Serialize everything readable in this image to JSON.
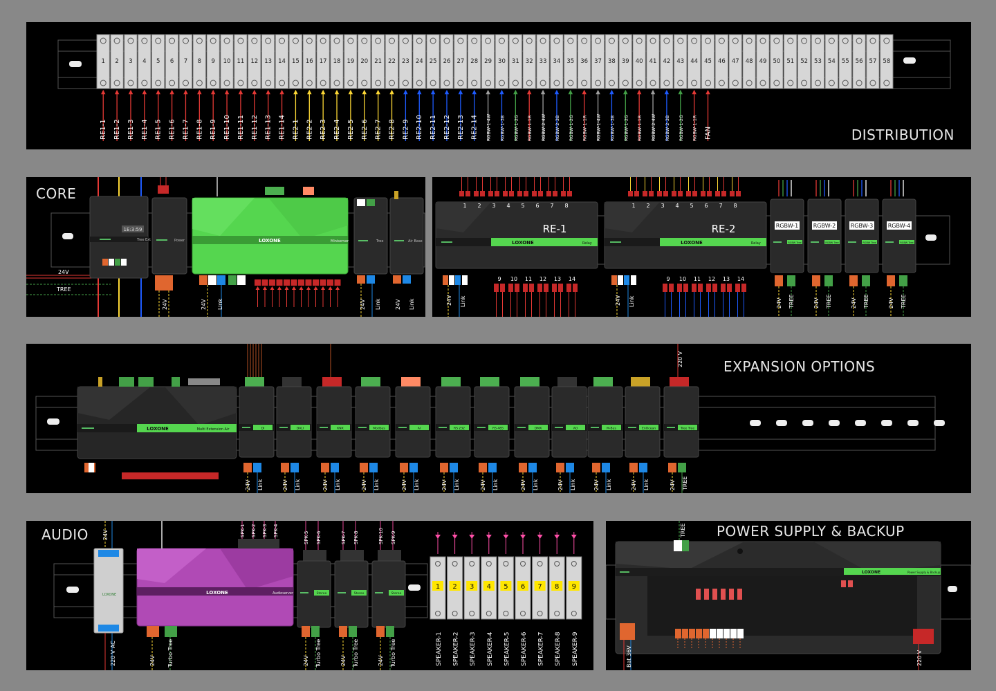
{
  "distribution": {
    "title": "DISTRIBUTION",
    "terminal_count": 58,
    "wires": [
      {
        "label": "RE1-1",
        "color": "#e53935"
      },
      {
        "label": "RE1-2",
        "color": "#e53935"
      },
      {
        "label": "RE1-3",
        "color": "#e53935"
      },
      {
        "label": "RE1-4",
        "color": "#e53935"
      },
      {
        "label": "RE1-5",
        "color": "#e53935"
      },
      {
        "label": "RE1-6",
        "color": "#e53935"
      },
      {
        "label": "RE1-7",
        "color": "#e53935"
      },
      {
        "label": "RE1-8",
        "color": "#e53935"
      },
      {
        "label": "RE1-9",
        "color": "#e53935"
      },
      {
        "label": "RE1-10",
        "color": "#e53935"
      },
      {
        "label": "RE1-11",
        "color": "#e53935"
      },
      {
        "label": "RE1-12",
        "color": "#e53935"
      },
      {
        "label": "RE1-13",
        "color": "#e53935"
      },
      {
        "label": "RE1-14",
        "color": "#e53935"
      },
      {
        "label": "RE2-1",
        "color": "#fdd835"
      },
      {
        "label": "RE2-2",
        "color": "#fdd835"
      },
      {
        "label": "RE2-3",
        "color": "#fdd835"
      },
      {
        "label": "RE2-4",
        "color": "#fdd835"
      },
      {
        "label": "RE2-5",
        "color": "#fdd835"
      },
      {
        "label": "RE2-6",
        "color": "#fdd835"
      },
      {
        "label": "RE2-7",
        "color": "#fdd835"
      },
      {
        "label": "RE2-8",
        "color": "#fdd835"
      },
      {
        "label": "RE2-9",
        "color": "#1e5bff"
      },
      {
        "label": "RE2-10",
        "color": "#1e5bff"
      },
      {
        "label": "RE2-11",
        "color": "#1e5bff"
      },
      {
        "label": "RE2-12",
        "color": "#1e5bff"
      },
      {
        "label": "RE2-13",
        "color": "#1e5bff"
      },
      {
        "label": "RE2-14",
        "color": "#1e5bff"
      },
      {
        "label": "RGBW-1-4W",
        "color": "#9e9e9e"
      },
      {
        "label": "RGBW-1-3B",
        "color": "#1e5bff"
      },
      {
        "label": "RGBW-1-2G",
        "color": "#43a047"
      },
      {
        "label": "RGBW-1-1R",
        "color": "#e53935"
      },
      {
        "label": "RGBW-2-4W",
        "color": "#9e9e9e"
      },
      {
        "label": "RGBW-2-3B",
        "color": "#1e5bff"
      },
      {
        "label": "RGBW-1-2G",
        "color": "#43a047"
      },
      {
        "label": "RGBW-1-1R",
        "color": "#e53935"
      },
      {
        "label": "RGBW-1-4W",
        "color": "#9e9e9e"
      },
      {
        "label": "RGBW-1-3B",
        "color": "#1e5bff"
      },
      {
        "label": "RGBW-1-2G",
        "color": "#43a047"
      },
      {
        "label": "RGBW-1-1R",
        "color": "#e53935"
      },
      {
        "label": "RGBW-2-4W",
        "color": "#9e9e9e"
      },
      {
        "label": "RGBW-2-3B",
        "color": "#1e5bff"
      },
      {
        "label": "RGBW-1-2G",
        "color": "#43a047"
      },
      {
        "label": "RGBW-1-1R",
        "color": "#e53935"
      },
      {
        "label": "FAN",
        "color": "#e53935"
      }
    ]
  },
  "core": {
    "title": "CORE",
    "wire_24v": "24V",
    "wire_tree": "TREE",
    "modules": {
      "tree_ext": "Tree Ext",
      "tree_id": "1E:3:59",
      "power": "Power",
      "miniserver_brand": "LOXONE",
      "miniserver_label": "Miniserver",
      "tree": "Tree",
      "air_base": "Air Base",
      "relay_brand": "LOXONE",
      "relay_label": "Relay",
      "re1": "RE-1",
      "re2": "RE-2",
      "rgbw": [
        "RGBW-1",
        "RGBW-2",
        "RGBW-3",
        "RGBW-4"
      ],
      "rgbw_label": "RGBW Tree"
    },
    "relay_top_numbers": [
      "1",
      "2",
      "3",
      "4",
      "5",
      "6",
      "7",
      "8"
    ],
    "relay_bottom_numbers": [
      "9",
      "10",
      "11",
      "12",
      "13",
      "14"
    ],
    "bottom_labels": {
      "v24": "24V",
      "link": "Link",
      "tree": "TREE"
    }
  },
  "expansion": {
    "title": "EXPANSION OPTIONS",
    "brand": "LOXONE",
    "big_label": "Multi Extension Air",
    "modules": [
      "DI",
      "DALI",
      "KNX",
      "Modbus",
      "AI",
      "RS 232",
      "RS 485",
      "DMX",
      "AO",
      "M-Bus",
      "EnOcean",
      "Tree Tree"
    ],
    "v220": "220 V",
    "v24": "24V",
    "link": "Link",
    "tree": "TREE"
  },
  "audio": {
    "title": "AUDIO",
    "brand": "LOXONE",
    "audioserver_label": "Audioserver",
    "stereo_label": "Stereo",
    "psu_brand": "LOXONE",
    "v24": "24V",
    "v220ac": "220 V AC",
    "turbo_tree": "Turbo Tree",
    "spk_top": [
      "SPK-1",
      "SPK-2",
      "SPK-3",
      "SPK-4"
    ],
    "spk_ext": [
      [
        "SPK-5",
        "SPK-6"
      ],
      [
        "SPK-7",
        "SPK-8"
      ],
      [
        "SPK-10",
        "SPK-9"
      ]
    ],
    "terminals": [
      "1",
      "2",
      "3",
      "4",
      "5",
      "6",
      "7",
      "8",
      "9"
    ],
    "speakers": [
      "SPEAKER-1",
      "SPEAKER-2",
      "SPEAKER-3",
      "SPEAKER-4",
      "SPEAKER-5",
      "SPEAKER-6",
      "SPEAKER-7",
      "SPEAKER-8",
      "SPEAKER-9"
    ]
  },
  "power": {
    "title": "POWER SUPPLY & BACKUP",
    "brand": "LOXONE",
    "label": "Power Supply & Backup",
    "tree": "TREE",
    "bat": "Bat 36V",
    "v220": "220 V"
  }
}
